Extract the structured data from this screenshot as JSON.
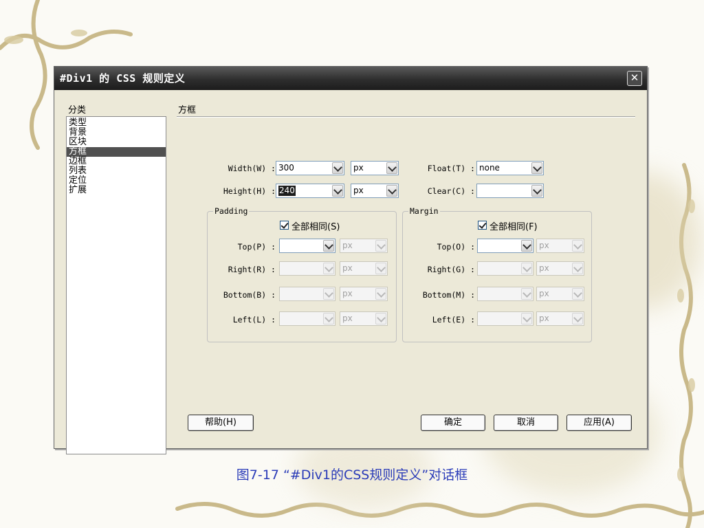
{
  "dialog": {
    "title": "#Div1 的 CSS 规则定义",
    "close_label": "✕",
    "category_label": "分类",
    "categories": [
      "类型",
      "背景",
      "区块",
      "方框",
      "边框",
      "列表",
      "定位",
      "扩展"
    ],
    "selected_category": "方框",
    "section_title": "方框",
    "width": {
      "label": "Width(W) :",
      "value": "300",
      "unit": "px"
    },
    "height": {
      "label": "Height(H) :",
      "value": "240",
      "unit": "px"
    },
    "float": {
      "label": "Float(T) :",
      "value": "none"
    },
    "clear": {
      "label": "Clear(C) :",
      "value": ""
    },
    "padding": {
      "title": "Padding",
      "same_for_all": "全部相同(S)",
      "top": {
        "label": "Top(P) :",
        "value": "",
        "unit": "px"
      },
      "right": {
        "label": "Right(R) :",
        "value": "",
        "unit": "px"
      },
      "bottom": {
        "label": "Bottom(B) :",
        "value": "",
        "unit": "px"
      },
      "left": {
        "label": "Left(L) :",
        "value": "",
        "unit": "px"
      }
    },
    "margin": {
      "title": "Margin",
      "same_for_all": "全部相同(F)",
      "top": {
        "label": "Top(O) :",
        "value": "",
        "unit": "px"
      },
      "right": {
        "label": "Right(G) :",
        "value": "",
        "unit": "px"
      },
      "bottom": {
        "label": "Bottom(M) :",
        "value": "",
        "unit": "px"
      },
      "left": {
        "label": "Left(E) :",
        "value": "",
        "unit": "px"
      }
    },
    "buttons": {
      "help": "帮助(H)",
      "ok": "确定",
      "cancel": "取消",
      "apply": "应用(A)"
    }
  },
  "caption": "图7-17 “#Div1的CSS规则定义”对话框",
  "colors": {
    "caption": "#2a3bb8",
    "titlebar": "#2e2e2e",
    "selection": "#505050"
  }
}
